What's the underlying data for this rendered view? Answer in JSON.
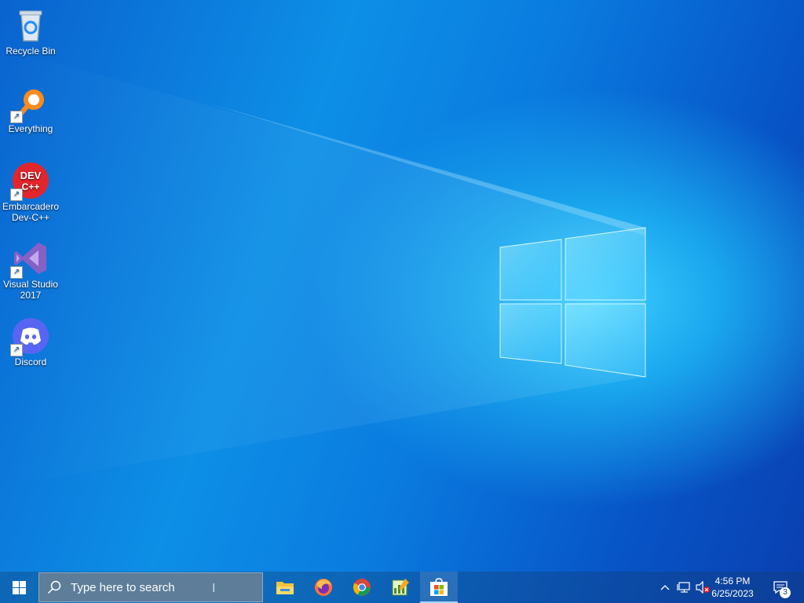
{
  "desktop": {
    "icons": [
      {
        "label": "Recycle Bin",
        "icon": "recycle-bin-icon"
      },
      {
        "label": "Everything",
        "icon": "everything-search-icon"
      },
      {
        "label": "Embarcadero Dev-C++",
        "icon": "dev-cpp-icon"
      },
      {
        "label": "Visual Studio 2017",
        "icon": "visual-studio-icon"
      },
      {
        "label": "Discord",
        "icon": "discord-icon"
      }
    ]
  },
  "taskbar": {
    "search_placeholder": "Type here to search",
    "apps": [
      "file-explorer-icon",
      "firefox-icon",
      "chrome-icon",
      "notepad-app-icon",
      "microsoft-store-icon"
    ],
    "tray": {
      "time": "4:56 PM",
      "date": "6/25/2023",
      "notification_count": "3"
    }
  },
  "colors": {
    "accent": "#0a7ce0",
    "windows_logo": "#7fe3ff"
  }
}
